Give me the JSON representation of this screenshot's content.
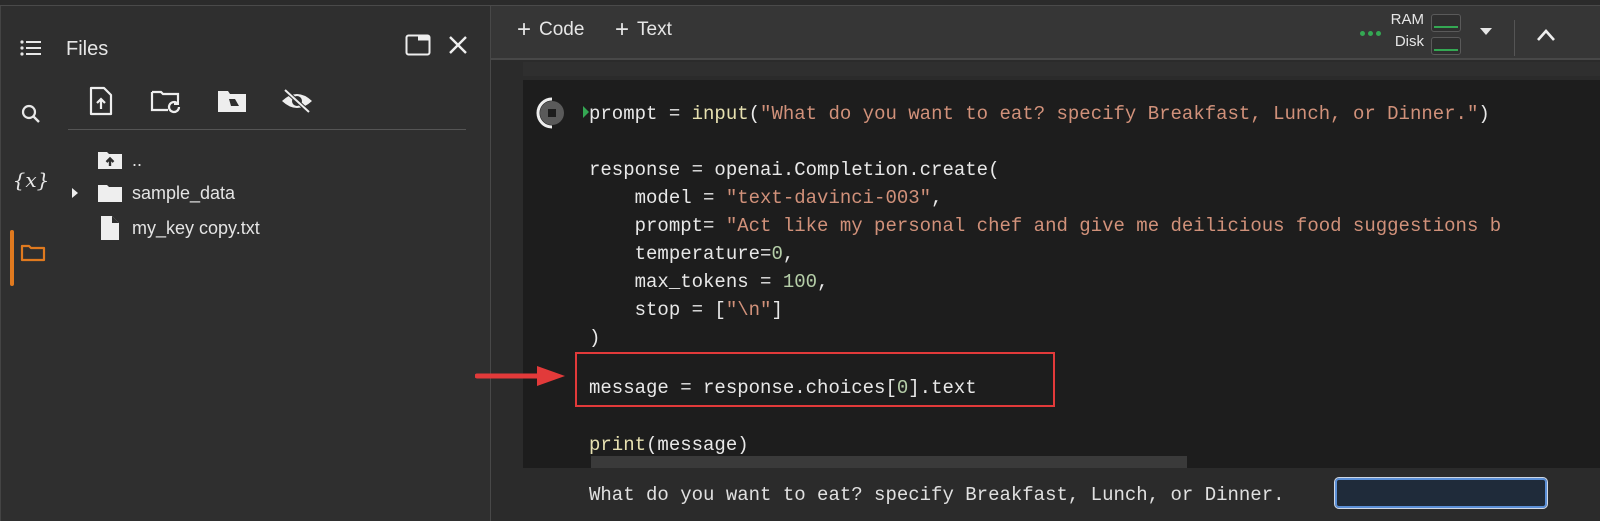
{
  "rail": {
    "items": [
      {
        "name": "table-of-contents",
        "icon": "list-icon"
      },
      {
        "name": "find",
        "icon": "search-icon"
      },
      {
        "name": "variables",
        "icon": "variables-icon",
        "glyph": "{x}"
      },
      {
        "name": "files",
        "icon": "folder-icon",
        "active": true
      }
    ],
    "accent_color": "#e07a1f"
  },
  "files_panel": {
    "title": "Files",
    "toolbar": [
      {
        "name": "upload-file",
        "icon": "upload-file-icon"
      },
      {
        "name": "refresh",
        "icon": "folder-refresh-icon"
      },
      {
        "name": "mount-drive",
        "icon": "drive-folder-icon"
      },
      {
        "name": "toggle-hidden",
        "icon": "eye-off-icon"
      }
    ],
    "items": [
      {
        "label": "..",
        "icon": "parent-folder-icon",
        "expandable": false
      },
      {
        "label": "sample_data",
        "icon": "folder-icon",
        "expandable": true
      },
      {
        "label": "my_key copy.txt",
        "icon": "file-icon",
        "expandable": false
      }
    ]
  },
  "toolbar": {
    "add_code_label": "Code",
    "add_text_label": "Text",
    "ram_label": "RAM",
    "disk_label": "Disk",
    "status_color": "#34a853"
  },
  "cell": {
    "code_lines": [
      {
        "parts": [
          {
            "t": "prompt = ",
            "c": ""
          },
          {
            "t": "input",
            "c": "fn"
          },
          {
            "t": "(",
            "c": ""
          },
          {
            "t": "\"What do you want to eat? specify Breakfast, Lunch, or Dinner.\"",
            "c": "str"
          },
          {
            "t": ")",
            "c": ""
          }
        ]
      },
      {
        "parts": []
      },
      {
        "parts": [
          {
            "t": "response = openai.Completion.create(",
            "c": ""
          }
        ]
      },
      {
        "parts": [
          {
            "t": "    model = ",
            "c": ""
          },
          {
            "t": "\"text-davinci-003\"",
            "c": "str"
          },
          {
            "t": ",",
            "c": ""
          }
        ]
      },
      {
        "parts": [
          {
            "t": "    prompt= ",
            "c": ""
          },
          {
            "t": "\"Act like my personal chef and give me deilicious food suggestions b",
            "c": "str"
          }
        ]
      },
      {
        "parts": [
          {
            "t": "    temperature=",
            "c": ""
          },
          {
            "t": "0",
            "c": "num"
          },
          {
            "t": ",",
            "c": ""
          }
        ]
      },
      {
        "parts": [
          {
            "t": "    max_tokens = ",
            "c": ""
          },
          {
            "t": "100",
            "c": "num"
          },
          {
            "t": ",",
            "c": ""
          }
        ]
      },
      {
        "parts": [
          {
            "t": "    stop = [",
            "c": ""
          },
          {
            "t": "\"\\n\"",
            "c": "str"
          },
          {
            "t": "]",
            "c": ""
          }
        ]
      },
      {
        "parts": [
          {
            "t": ")",
            "c": ""
          }
        ]
      },
      {
        "parts": []
      },
      {
        "parts": [
          {
            "t": "message = response.choices[",
            "c": ""
          },
          {
            "t": "0",
            "c": "num"
          },
          {
            "t": "].text",
            "c": ""
          }
        ]
      },
      {
        "parts": []
      },
      {
        "parts": [
          {
            "t": "print",
            "c": "fn"
          },
          {
            "t": "(message)",
            "c": ""
          }
        ]
      }
    ],
    "highlight_color": "#e23a3a"
  },
  "output": {
    "prompt_text": "What do you want to eat? specify Breakfast, Lunch, or Dinner.",
    "input_value": ""
  }
}
